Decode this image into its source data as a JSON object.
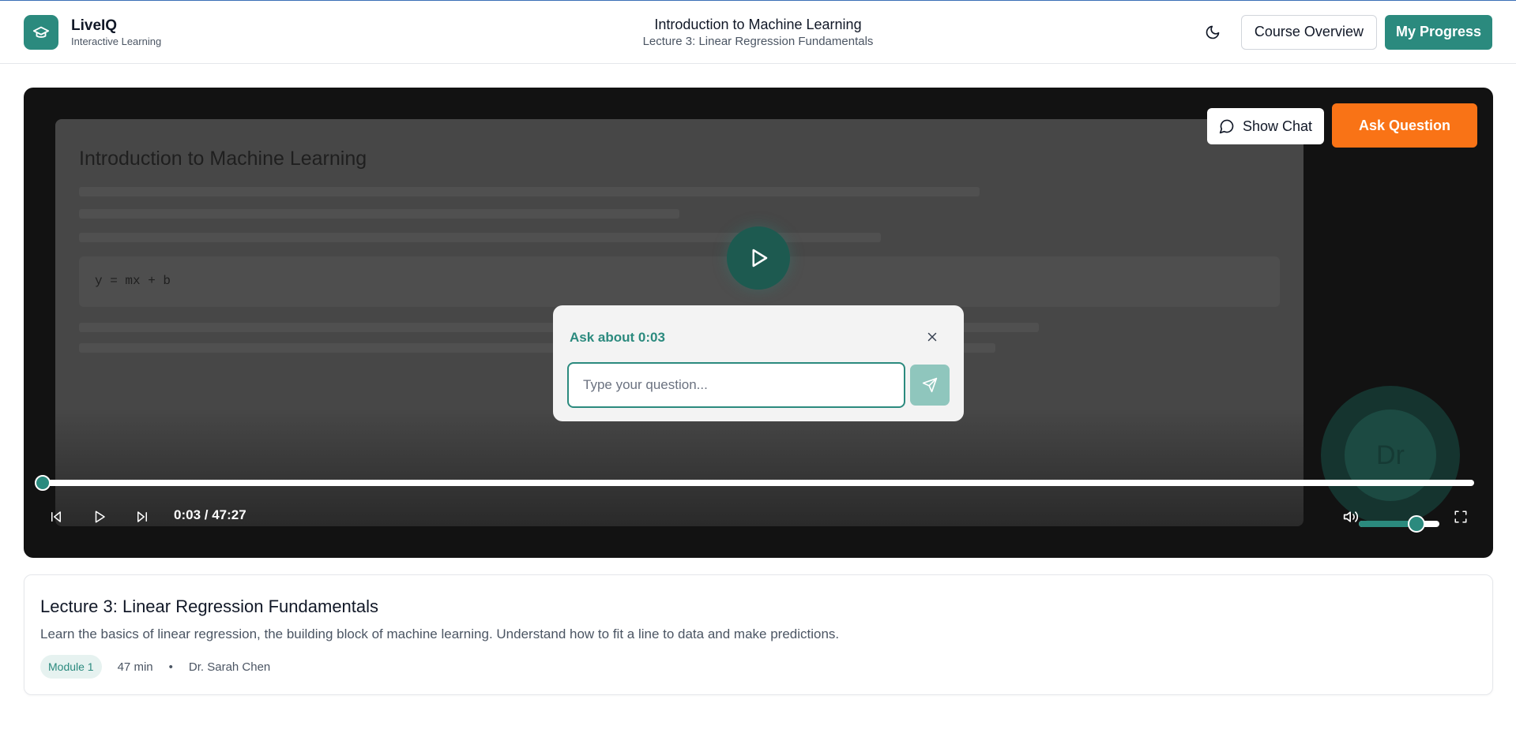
{
  "brand": {
    "name": "LiveIQ",
    "tagline": "Interactive Learning",
    "logo_icon": "graduation-cap-icon",
    "color": "#2b8a7e"
  },
  "header": {
    "course_title": "Introduction to Machine Learning",
    "lecture_subtitle": "Lecture 3: Linear Regression Fundamentals",
    "theme_icon": "moon-icon",
    "course_overview_label": "Course Overview",
    "my_progress_label": "My Progress"
  },
  "player": {
    "slide_title": "Introduction to Machine Learning",
    "formula": "y = mx + b",
    "webcam_initials": "Dr",
    "show_chat_label": "Show Chat",
    "ask_question_label": "Ask Question",
    "current_time": "0:03",
    "total_time": "47:27",
    "time_display": "0:03 / 47:27",
    "progress_fraction": 0.0011,
    "volume_fraction": 0.72,
    "accent_color": "#2b8a7e",
    "ask_button_color": "#f97316"
  },
  "ask_popup": {
    "title": "Ask about 0:03",
    "placeholder": "Type your question..."
  },
  "lecture_info": {
    "title": "Lecture 3: Linear Regression Fundamentals",
    "description": "Learn the basics of linear regression, the building block of machine learning. Understand how to fit a line to data and make predictions.",
    "module": "Module 1",
    "duration": "47 min",
    "separator": "•",
    "instructor": "Dr. Sarah Chen"
  }
}
